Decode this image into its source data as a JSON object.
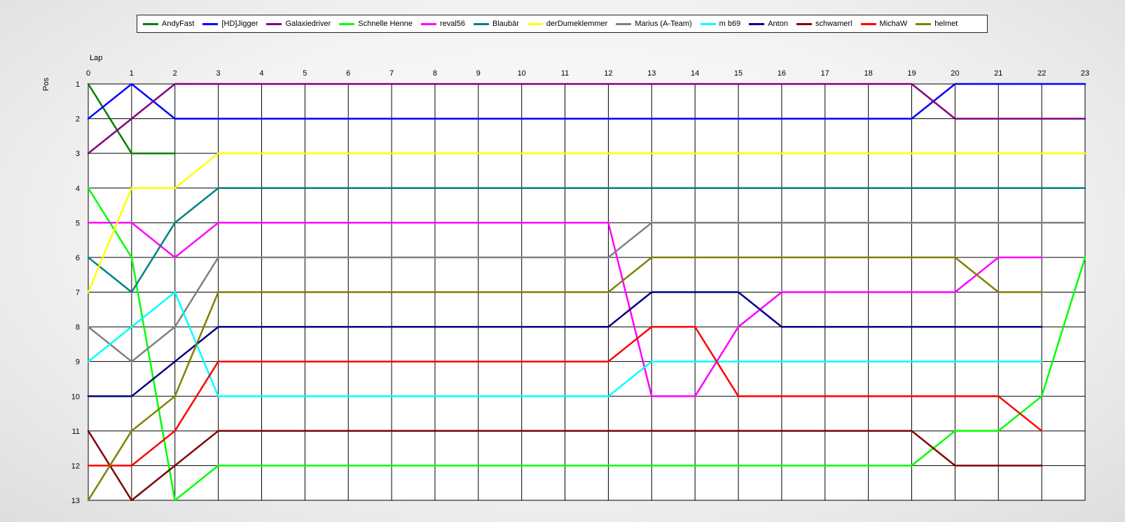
{
  "chart_data": {
    "type": "line",
    "xlabel": "Lap",
    "ylabel": "Pos",
    "xlim": [
      0,
      23
    ],
    "ylim": [
      1,
      13
    ],
    "y_inverted": true,
    "grid": true,
    "legend_placement": "top",
    "x_ticks": [
      "0",
      "1",
      "2",
      "3",
      "4",
      "5",
      "6",
      "7",
      "8",
      "9",
      "10",
      "11",
      "12",
      "13",
      "14",
      "15",
      "16",
      "17",
      "18",
      "19",
      "20",
      "21",
      "22",
      "23"
    ],
    "y_ticks": [
      "1",
      "2",
      "3",
      "4",
      "5",
      "6",
      "7",
      "8",
      "9",
      "10",
      "11",
      "12",
      "13"
    ],
    "series": [
      {
        "name": "AndyFast",
        "color": "#008000",
        "x": [
          0,
          1,
          2
        ],
        "y": [
          1,
          3,
          3
        ]
      },
      {
        "name": "[HD]Jigger",
        "color": "#0000ff",
        "x": [
          0,
          1,
          2,
          3,
          4,
          5,
          6,
          7,
          8,
          9,
          10,
          11,
          12,
          13,
          14,
          15,
          16,
          17,
          18,
          19,
          20,
          21,
          22,
          23
        ],
        "y": [
          2,
          1,
          2,
          2,
          2,
          2,
          2,
          2,
          2,
          2,
          2,
          2,
          2,
          2,
          2,
          2,
          2,
          2,
          2,
          2,
          1,
          1,
          1,
          1
        ]
      },
      {
        "name": "Galaxiedriver",
        "color": "#800080",
        "x": [
          0,
          1,
          2,
          3,
          4,
          5,
          6,
          7,
          8,
          9,
          10,
          11,
          12,
          13,
          14,
          15,
          16,
          17,
          18,
          19,
          20,
          21,
          22,
          23
        ],
        "y": [
          3,
          2,
          1,
          1,
          1,
          1,
          1,
          1,
          1,
          1,
          1,
          1,
          1,
          1,
          1,
          1,
          1,
          1,
          1,
          1,
          2,
          2,
          2,
          2
        ]
      },
      {
        "name": "Schnelle Henne",
        "color": "#00ff00",
        "x": [
          0,
          1,
          2,
          3,
          4,
          5,
          6,
          7,
          8,
          9,
          10,
          11,
          12,
          13,
          14,
          15,
          16,
          17,
          18,
          19,
          20,
          21,
          22,
          23
        ],
        "y": [
          4,
          6,
          13,
          12,
          12,
          12,
          12,
          12,
          12,
          12,
          12,
          12,
          12,
          12,
          12,
          12,
          12,
          12,
          12,
          12,
          11,
          11,
          10,
          6
        ]
      },
      {
        "name": "reval56",
        "color": "#ff00ff",
        "x": [
          0,
          1,
          2,
          3,
          4,
          5,
          6,
          7,
          8,
          9,
          10,
          11,
          12,
          13,
          14,
          15,
          16,
          17,
          18,
          19,
          20,
          21,
          22
        ],
        "y": [
          5,
          5,
          6,
          5,
          5,
          5,
          5,
          5,
          5,
          5,
          5,
          5,
          5,
          10,
          10,
          8,
          7,
          7,
          7,
          7,
          7,
          6,
          6
        ]
      },
      {
        "name": "Blaubär",
        "color": "#008080",
        "x": [
          0,
          1,
          2,
          3,
          4,
          5,
          6,
          7,
          8,
          9,
          10,
          11,
          12,
          13,
          14,
          15,
          16,
          17,
          18,
          19,
          20,
          21,
          22,
          23
        ],
        "y": [
          6,
          7,
          5,
          4,
          4,
          4,
          4,
          4,
          4,
          4,
          4,
          4,
          4,
          4,
          4,
          4,
          4,
          4,
          4,
          4,
          4,
          4,
          4,
          4
        ]
      },
      {
        "name": "derDumeklemmer",
        "color": "#ffff00",
        "x": [
          0,
          1,
          2,
          3,
          4,
          5,
          6,
          7,
          8,
          9,
          10,
          11,
          12,
          13,
          14,
          15,
          16,
          17,
          18,
          19,
          20,
          21,
          22,
          23
        ],
        "y": [
          7,
          4,
          4,
          3,
          3,
          3,
          3,
          3,
          3,
          3,
          3,
          3,
          3,
          3,
          3,
          3,
          3,
          3,
          3,
          3,
          3,
          3,
          3,
          3
        ]
      },
      {
        "name": "Marius (A-Team)",
        "color": "#808080",
        "x": [
          0,
          1,
          2,
          3,
          4,
          5,
          6,
          7,
          8,
          9,
          10,
          11,
          12,
          13,
          14,
          15,
          16,
          17,
          18,
          19,
          20,
          21,
          22,
          23
        ],
        "y": [
          8,
          9,
          8,
          6,
          6,
          6,
          6,
          6,
          6,
          6,
          6,
          6,
          6,
          5,
          5,
          5,
          5,
          5,
          5,
          5,
          5,
          5,
          5,
          5
        ]
      },
      {
        "name": "m b69",
        "color": "#00ffff",
        "x": [
          0,
          1,
          2,
          3,
          4,
          5,
          6,
          7,
          8,
          9,
          10,
          11,
          12,
          13,
          14,
          15,
          16,
          17,
          18,
          19,
          20,
          21,
          22
        ],
        "y": [
          9,
          8,
          7,
          10,
          10,
          10,
          10,
          10,
          10,
          10,
          10,
          10,
          10,
          9,
          9,
          9,
          9,
          9,
          9,
          9,
          9,
          9,
          9
        ]
      },
      {
        "name": "Anton",
        "color": "#000080",
        "x": [
          0,
          1,
          2,
          3,
          4,
          5,
          6,
          7,
          8,
          9,
          10,
          11,
          12,
          13,
          14,
          15,
          16,
          17,
          18,
          19,
          20,
          21,
          22
        ],
        "y": [
          10,
          10,
          9,
          8,
          8,
          8,
          8,
          8,
          8,
          8,
          8,
          8,
          8,
          7,
          7,
          7,
          8,
          8,
          8,
          8,
          8,
          8,
          8
        ]
      },
      {
        "name": "schwamerl",
        "color": "#800000",
        "x": [
          0,
          1,
          2,
          3,
          4,
          5,
          6,
          7,
          8,
          9,
          10,
          11,
          12,
          13,
          14,
          15,
          16,
          17,
          18,
          19,
          20,
          21,
          22
        ],
        "y": [
          11,
          13,
          12,
          11,
          11,
          11,
          11,
          11,
          11,
          11,
          11,
          11,
          11,
          11,
          11,
          11,
          11,
          11,
          11,
          11,
          12,
          12,
          12
        ]
      },
      {
        "name": "MichaW",
        "color": "#ff0000",
        "x": [
          0,
          1,
          2,
          3,
          4,
          5,
          6,
          7,
          8,
          9,
          10,
          11,
          12,
          13,
          14,
          15,
          16,
          17,
          18,
          19,
          20,
          21,
          22
        ],
        "y": [
          12,
          12,
          11,
          9,
          9,
          9,
          9,
          9,
          9,
          9,
          9,
          9,
          9,
          8,
          8,
          10,
          10,
          10,
          10,
          10,
          10,
          10,
          11
        ]
      },
      {
        "name": "helmet",
        "color": "#808000",
        "x": [
          0,
          1,
          2,
          3,
          4,
          5,
          6,
          7,
          8,
          9,
          10,
          11,
          12,
          13,
          14,
          15,
          16,
          17,
          18,
          19,
          20,
          21,
          22
        ],
        "y": [
          13,
          11,
          10,
          7,
          7,
          7,
          7,
          7,
          7,
          7,
          7,
          7,
          7,
          6,
          6,
          6,
          6,
          6,
          6,
          6,
          6,
          7,
          7
        ]
      }
    ]
  }
}
